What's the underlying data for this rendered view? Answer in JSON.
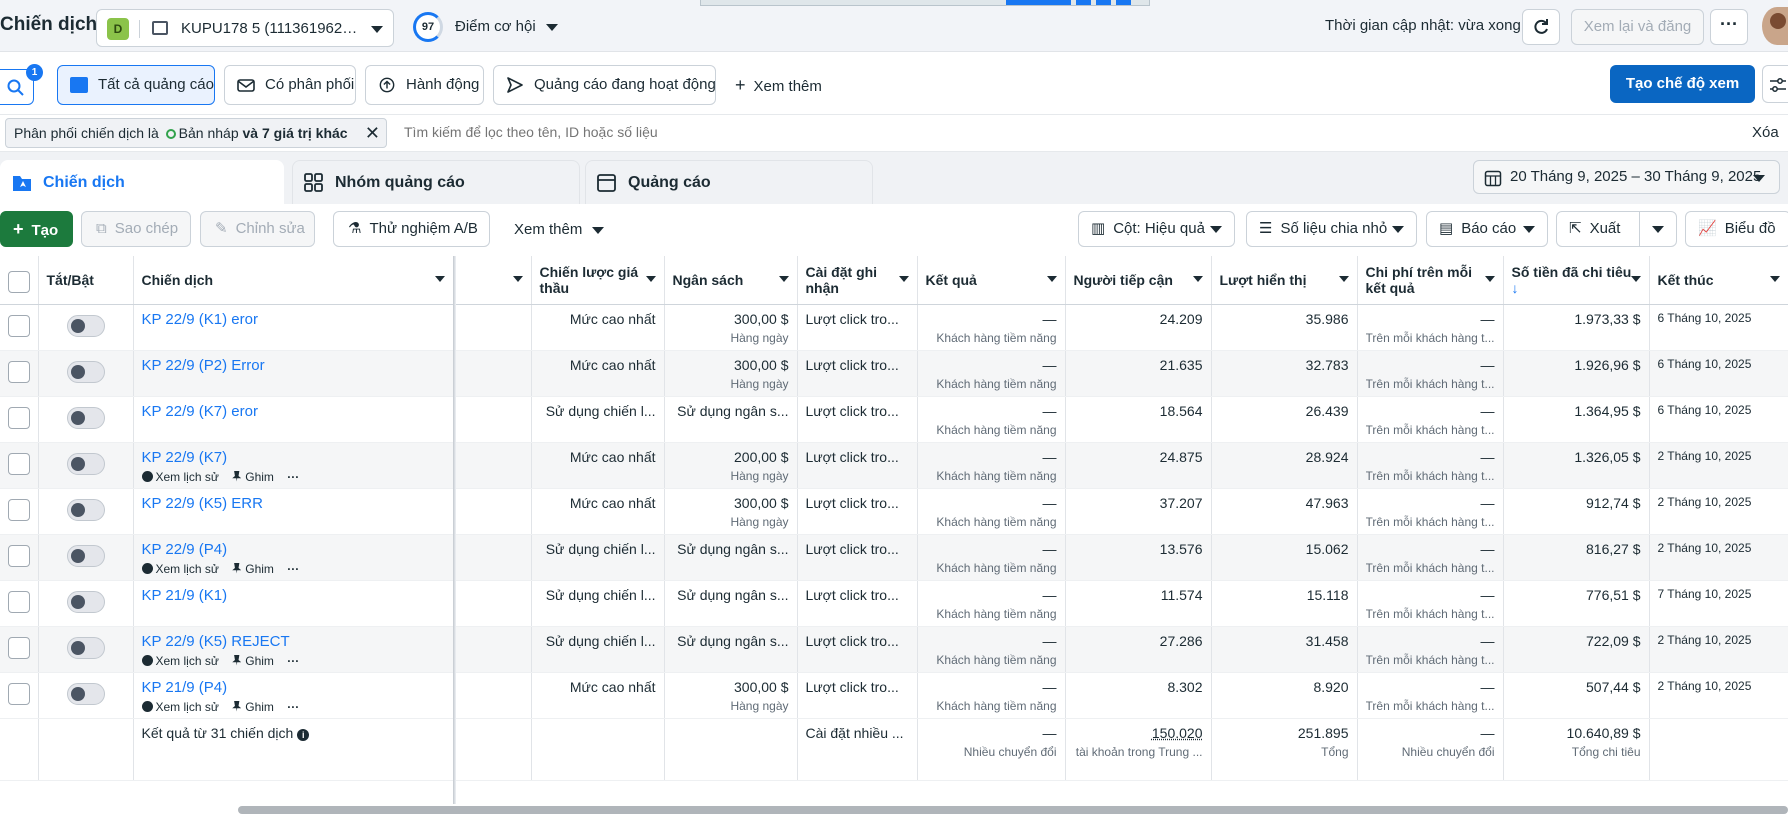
{
  "header": {
    "title": "Chiến dịch",
    "account_badge": "D",
    "account_name": "KUPU178 5 (1113619624...",
    "opportunity_score": "97",
    "opportunity_label": "Điểm cơ hội",
    "updated_text": "Thời gian cập nhật: vừa xong",
    "review_publish": "Xem lại và đăng",
    "more_label": "···"
  },
  "views": {
    "search_badge": "1",
    "all_ads": "Tất cả quảng cáo",
    "has_delivery": "Có phân phối",
    "actions": "Hành động",
    "active_ads": "Quảng cáo đang hoạt động",
    "see_more": "Xem thêm",
    "create_view": "Tạo chế độ xem"
  },
  "filter": {
    "prefix": "Phân phối chiến dịch là",
    "value": "Bản nháp",
    "suffix": "và 7 giá trị khác",
    "close": "✕",
    "placeholder": "Tìm kiếm để lọc theo tên, ID hoặc số liệu",
    "clear": "Xóa"
  },
  "tabs": {
    "campaigns": "Chiến dịch",
    "ad_sets": "Nhóm quảng cáo",
    "ads": "Quảng cáo",
    "date_range": "20 Tháng 9, 2025 – 30 Tháng 9, 2025"
  },
  "toolbar": {
    "create": "Tạo",
    "duplicate": "Sao chép",
    "edit": "Chỉnh sửa",
    "ab_test": "Thử nghiệm A/B",
    "see_more": "Xem thêm",
    "columns": "Cột: Hiệu quả",
    "breakdown": "Số liệu chia nhỏ",
    "reports": "Báo cáo",
    "export": "Xuất",
    "chart": "Biểu đồ"
  },
  "columns": {
    "toggle": "Tắt/Bật",
    "campaign": "Chiến dịch",
    "bid_strategy": "Chiến lược giá thầu",
    "budget": "Ngân sách",
    "attribution": "Cài đặt ghi nhận",
    "results": "Kết quả",
    "reach": "Người tiếp cận",
    "impressions": "Lượt hiển thị",
    "cost_per_result": "Chi phí trên mỗi kết quả",
    "amount_spent": "Số tiền đã chi tiêu",
    "sort_arrow": "↓",
    "ends": "Kết thúc"
  },
  "row_actions": {
    "history": "Xem lịch sử",
    "pin": "Ghim",
    "more": "···"
  },
  "rows": [
    {
      "name": "KP 22/9 (K1) eror",
      "show_actions": false,
      "bid": "Mức cao nhất",
      "budget": "300,00 $",
      "budget_sub": "Hàng ngày",
      "attr": "Lượt click tro...",
      "result": "—",
      "result_sub": "Khách hàng tiềm năng",
      "reach": "24.209",
      "impr": "35.986",
      "cpr": "—",
      "cpr_sub": "Trên mỗi khách hàng t...",
      "spent": "1.973,33 $",
      "ends": "6 Tháng 10, 2025"
    },
    {
      "name": "KP 22/9 (P2) Error",
      "show_actions": false,
      "bid": "Mức cao nhất",
      "budget": "300,00 $",
      "budget_sub": "Hàng ngày",
      "attr": "Lượt click tro...",
      "result": "—",
      "result_sub": "Khách hàng tiềm năng",
      "reach": "21.635",
      "impr": "32.783",
      "cpr": "—",
      "cpr_sub": "Trên mỗi khách hàng t...",
      "spent": "1.926,96 $",
      "ends": "6 Tháng 10, 2025"
    },
    {
      "name": "KP 22/9 (K7) eror",
      "show_actions": false,
      "bid": "Sử dụng chiến l...",
      "budget": "Sử dụng ngân s...",
      "budget_sub": "",
      "attr": "Lượt click tro...",
      "result": "—",
      "result_sub": "Khách hàng tiềm năng",
      "reach": "18.564",
      "impr": "26.439",
      "cpr": "—",
      "cpr_sub": "Trên mỗi khách hàng t...",
      "spent": "1.364,95 $",
      "ends": "6 Tháng 10, 2025"
    },
    {
      "name": "KP 22/9 (K7)",
      "show_actions": true,
      "bid": "Mức cao nhất",
      "budget": "200,00 $",
      "budget_sub": "Hàng ngày",
      "attr": "Lượt click tro...",
      "result": "—",
      "result_sub": "Khách hàng tiềm năng",
      "reach": "24.875",
      "impr": "28.924",
      "cpr": "—",
      "cpr_sub": "Trên mỗi khách hàng t...",
      "spent": "1.326,05 $",
      "ends": "2 Tháng 10, 2025"
    },
    {
      "name": "KP 22/9 (K5) ERR",
      "show_actions": false,
      "bid": "Mức cao nhất",
      "budget": "300,00 $",
      "budget_sub": "Hàng ngày",
      "attr": "Lượt click tro...",
      "result": "—",
      "result_sub": "Khách hàng tiềm năng",
      "reach": "37.207",
      "impr": "47.963",
      "cpr": "—",
      "cpr_sub": "Trên mỗi khách hàng t...",
      "spent": "912,74 $",
      "ends": "2 Tháng 10, 2025"
    },
    {
      "name": "KP 22/9 (P4)",
      "show_actions": true,
      "bid": "Sử dụng chiến l...",
      "budget": "Sử dụng ngân s...",
      "budget_sub": "",
      "attr": "Lượt click tro...",
      "result": "—",
      "result_sub": "Khách hàng tiềm năng",
      "reach": "13.576",
      "impr": "15.062",
      "cpr": "—",
      "cpr_sub": "Trên mỗi khách hàng t...",
      "spent": "816,27 $",
      "ends": "2 Tháng 10, 2025"
    },
    {
      "name": "KP 21/9 (K1)",
      "show_actions": false,
      "bid": "Sử dụng chiến l...",
      "budget": "Sử dụng ngân s...",
      "budget_sub": "",
      "attr": "Lượt click tro...",
      "result": "—",
      "result_sub": "Khách hàng tiềm năng",
      "reach": "11.574",
      "impr": "15.118",
      "cpr": "—",
      "cpr_sub": "Trên mỗi khách hàng t...",
      "spent": "776,51 $",
      "ends": "7 Tháng 10, 2025"
    },
    {
      "name": "KP 22/9 (K5) REJECT",
      "show_actions": true,
      "bid": "Sử dụng chiến l...",
      "budget": "Sử dụng ngân s...",
      "budget_sub": "",
      "attr": "Lượt click tro...",
      "result": "—",
      "result_sub": "Khách hàng tiềm năng",
      "reach": "27.286",
      "impr": "31.458",
      "cpr": "—",
      "cpr_sub": "Trên mỗi khách hàng t...",
      "spent": "722,09 $",
      "ends": "2 Tháng 10, 2025"
    },
    {
      "name": "KP 21/9 (P4)",
      "show_actions": true,
      "bid": "Mức cao nhất",
      "budget": "300,00 $",
      "budget_sub": "Hàng ngày",
      "attr": "Lượt click tro...",
      "result": "—",
      "result_sub": "Khách hàng tiềm năng",
      "reach": "8.302",
      "impr": "8.920",
      "cpr": "—",
      "cpr_sub": "Trên mỗi khách hàng t...",
      "spent": "507,44 $",
      "ends": "2 Tháng 10, 2025"
    }
  ],
  "summary": {
    "label": "Kết quả từ 31 chiến dịch",
    "attr": "Cài đặt nhiều ...",
    "result": "—",
    "result_sub": "Nhiều chuyển đổi",
    "reach": "150.020",
    "reach_sub": "tài khoản trong Trung ...",
    "impr": "251.895",
    "impr_sub": "Tổng",
    "cpr": "—",
    "cpr_sub": "Nhiều chuyển đổi",
    "spent": "10.640,89 $",
    "spent_sub": "Tổng chi tiêu"
  },
  "colors": {
    "brand_blue": "#1877f2",
    "create_green": "#1c7a3d"
  }
}
